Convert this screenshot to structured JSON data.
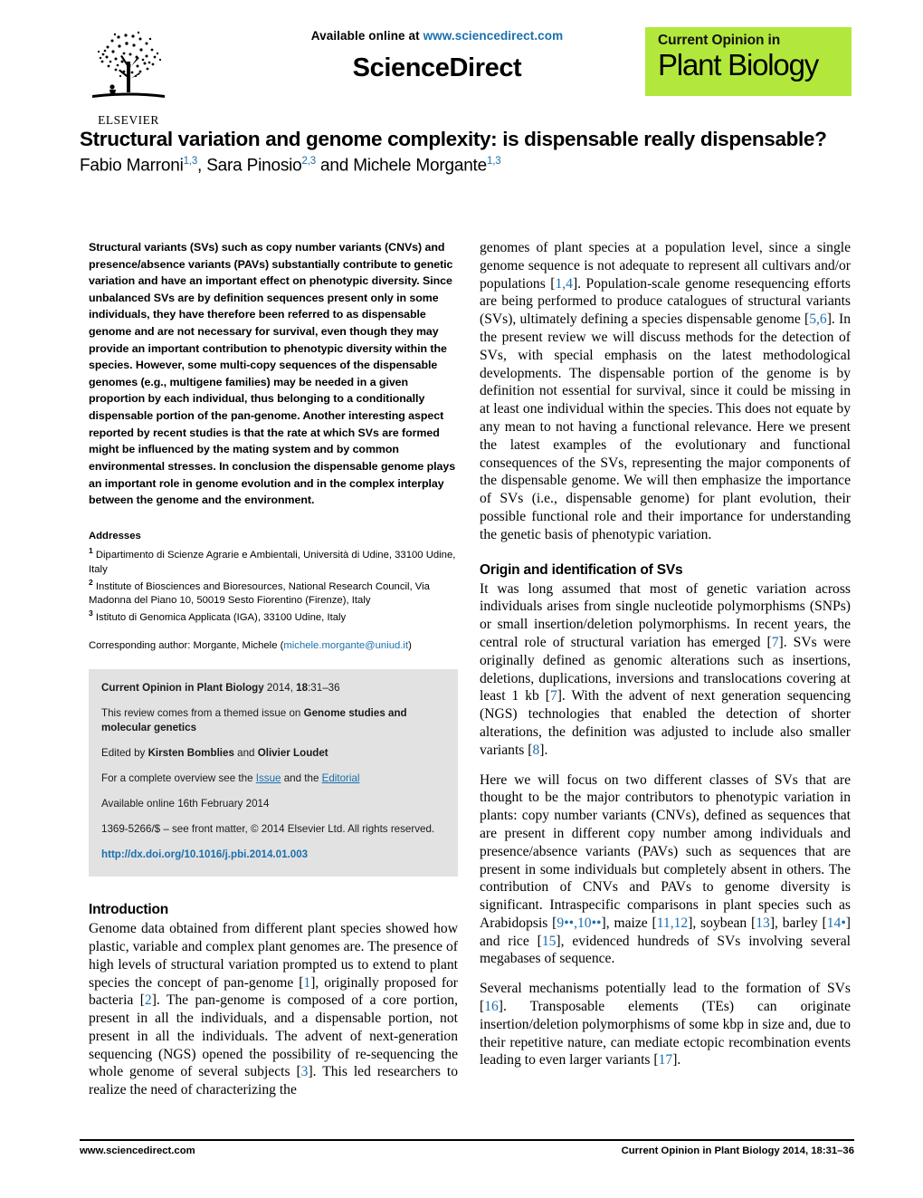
{
  "header": {
    "available_online": "Available online at ",
    "sciencedirect_url": "www.sciencedirect.com",
    "sciencedirect_wordmark": "ScienceDirect",
    "publisher_name": "ELSEVIER",
    "journal_logo_top": "Current Opinion in",
    "journal_logo_bottom": "Plant Biology",
    "journal_logo_bg": "#b2e83c",
    "link_color": "#1a6fad"
  },
  "article": {
    "title": "Structural variation and genome complexity: is dispensable really dispensable?",
    "authors": [
      {
        "name": "Fabio Marroni",
        "affiliations": "1,3",
        "separator": ", "
      },
      {
        "name": "Sara Pinosio",
        "affiliations": "2,3",
        "separator": " and "
      },
      {
        "name": "Michele Morgante",
        "affiliations": "1,3",
        "separator": ""
      }
    ]
  },
  "abstract": {
    "text": "Structural variants (SVs) such as copy number variants (CNVs) and presence/absence variants (PAVs) substantially contribute to genetic variation and have an important effect on phenotypic diversity. Since unbalanced SVs are by definition sequences present only in some individuals, they have therefore been referred to as dispensable genome and are not necessary for survival, even though they may provide an important contribution to phenotypic diversity within the species. However, some multi-copy sequences of the dispensable genomes (e.g., multigene families) may be needed in a given proportion by each individual, thus belonging to a conditionally dispensable portion of the pan-genome. Another interesting aspect reported by recent studies is that the rate at which SVs are formed might be influenced by the mating system and by common environmental stresses. In conclusion the dispensable genome plays an important role in genome evolution and in the complex interplay between the genome and the environment."
  },
  "addresses": {
    "heading": "Addresses",
    "items": [
      {
        "marker": "1",
        "text": "Dipartimento di Scienze Agrarie e Ambientali, Università di Udine, 33100 Udine, Italy"
      },
      {
        "marker": "2",
        "text": "Institute of Biosciences and Bioresources, National Research Council, Via Madonna del Piano 10, 50019 Sesto Fiorentino (Firenze), Italy"
      },
      {
        "marker": "3",
        "text": "Istituto di Genomica Applicata (IGA), 33100 Udine, Italy"
      }
    ],
    "corresponding_prefix": "Corresponding author: Morgante, Michele (",
    "corresponding_email": "michele.morgante@uniud.it",
    "corresponding_suffix": ")"
  },
  "citebox": {
    "journal_name": "Current Opinion in Plant Biology",
    "citation_rest": " 2014, ",
    "volume": "18",
    "pages": ":31–36",
    "themed_prefix": "This review comes from a themed issue on ",
    "themed_issue": "Genome studies and molecular genetics",
    "edited_prefix": "Edited by ",
    "editor_one": "Kirsten Bomblies",
    "edited_join": " and ",
    "editor_two": "Olivier Loudet",
    "overview_prefix": "For a complete overview see the ",
    "overview_link_issue": "Issue",
    "overview_join": " and the ",
    "overview_link_editorial": "Editorial",
    "available_online": "Available online 16th February 2014",
    "front_matter": "1369-5266/$ – see front matter, © 2014 Elsevier Ltd. All rights reserved.",
    "doi": "http://dx.doi.org/10.1016/j.pbi.2014.01.003"
  },
  "sections": {
    "introduction": {
      "heading": "Introduction",
      "paragraph_left_part1": "Genome data obtained from different plant species showed how plastic, variable and complex plant genomes are. The presence of high levels of structural variation prompted us to extend to plant species the concept of pan-genome [",
      "ref_1": "1",
      "paragraph_left_part2": "], originally proposed for bacteria [",
      "ref_2": "2",
      "paragraph_left_part3": "]. The pan-genome is composed of a core portion, present in all the individuals, and a dispensable portion, not present in all the individuals. The advent of next-generation sequencing (NGS) opened the possibility of re-sequencing the whole genome of several subjects [",
      "ref_3": "3",
      "paragraph_left_part4": "]. This led researchers to realize the need of characterizing the",
      "paragraph_right_part1": "genomes of plant species at a population level, since a single genome sequence is not adequate to represent all cultivars and/or populations [",
      "ref_1_4": "1,4",
      "paragraph_right_part2": "]. Population-scale genome resequencing efforts are being performed to produce catalogues of structural variants (SVs), ultimately defining a species dispensable genome [",
      "ref_5_6": "5,6",
      "paragraph_right_part3": "]. In the present review we will discuss methods for the detection of SVs, with special emphasis on the latest methodological developments. The dispensable portion of the genome is by definition not essential for survival, since it could be missing in at least one individual within the species. This does not equate by any mean to not having a functional relevance. Here we present the latest examples of the evolutionary and functional consequences of the SVs, representing the major components of the dispensable genome. We will then emphasize the importance of SVs (i.e., dispensable genome) for plant evolution, their possible functional role and their importance for understanding the genetic basis of phenotypic variation."
    },
    "origin": {
      "heading": "Origin and identification of SVs",
      "p1_part1": "It was long assumed that most of genetic variation across individuals arises from single nucleotide polymorphisms (SNPs) or small insertion/deletion polymorphisms. In recent years, the central role of structural variation has emerged [",
      "p1_ref7a": "7",
      "p1_part2": "]. SVs were originally defined as genomic alterations such as insertions, deletions, duplications, inversions and translocations covering at least 1 kb [",
      "p1_ref7b": "7",
      "p1_part3": "]. With the advent of next generation sequencing (NGS) technologies that enabled the detection of shorter alterations, the definition was adjusted to include also smaller variants [",
      "p1_ref8": "8",
      "p1_part4": "].",
      "p2_part1": "Here we will focus on two different classes of SVs that are thought to be the major contributors to phenotypic variation in plants: copy number variants (CNVs), defined as sequences that are present in different copy number among individuals and presence/absence variants (PAVs) such as sequences that are present in some individuals but completely absent in others. The contribution of CNVs and PAVs to genome diversity is significant. Intraspecific comparisons in plant species such as Arabidopsis [",
      "p2_ref9_10": "9••,10••",
      "p2_part2": "], maize [",
      "p2_ref11_12": "11,12",
      "p2_part3": "], soybean [",
      "p2_ref13": "13",
      "p2_part4": "], barley [",
      "p2_ref14": "14•",
      "p2_part5": "] and rice [",
      "p2_ref15": "15",
      "p2_part6": "], evidenced hundreds of SVs involving several megabases of sequence.",
      "p3_part1": "Several mechanisms potentially lead to the formation of SVs [",
      "p3_ref16": "16",
      "p3_part2": "]. Transposable elements (TEs) can originate insertion/deletion polymorphisms of some kbp in size and, due to their repetitive nature, can mediate ectopic recombination events leading to even larger variants [",
      "p3_ref17": "17",
      "p3_part3": "]."
    }
  },
  "footer": {
    "left": "www.sciencedirect.com",
    "right_journal": "Current Opinion in Plant Biology",
    "right_rest": " 2014, 18:31–36"
  }
}
